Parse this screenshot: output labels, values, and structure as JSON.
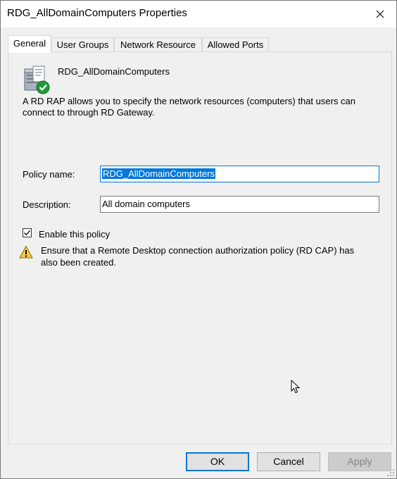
{
  "window": {
    "title": "RDG_AllDomainComputers Properties"
  },
  "tabs": [
    {
      "label": "General",
      "active": true
    },
    {
      "label": "User Groups",
      "active": false
    },
    {
      "label": "Network Resource",
      "active": false
    },
    {
      "label": "Allowed Ports",
      "active": false
    }
  ],
  "general": {
    "policy_heading": "RDG_AllDomainComputers",
    "intro": "A RD RAP allows you to specify the network resources (computers) that users can connect to through RD Gateway.",
    "policy_name_label": "Policy name:",
    "policy_name_value": "RDG_AllDomainComputers",
    "description_label": "Description:",
    "description_value": "All domain computers",
    "enable_label": "Enable this policy",
    "enable_checked": true,
    "warning": "Ensure that a Remote Desktop connection authorization policy (RD CAP) has also been created."
  },
  "buttons": {
    "ok": "OK",
    "cancel": "Cancel",
    "apply": "Apply"
  },
  "icons": {
    "close": "close-icon",
    "policy": "server-policy-icon",
    "checkmark": "checkmark-icon",
    "warning": "warning-icon",
    "cursor": "mouse-cursor-icon"
  },
  "colors": {
    "accent": "#0078d7",
    "window_bg": "#f0f0f0",
    "warning_yellow": "#f7c948",
    "check_green": "#1f9b35"
  }
}
